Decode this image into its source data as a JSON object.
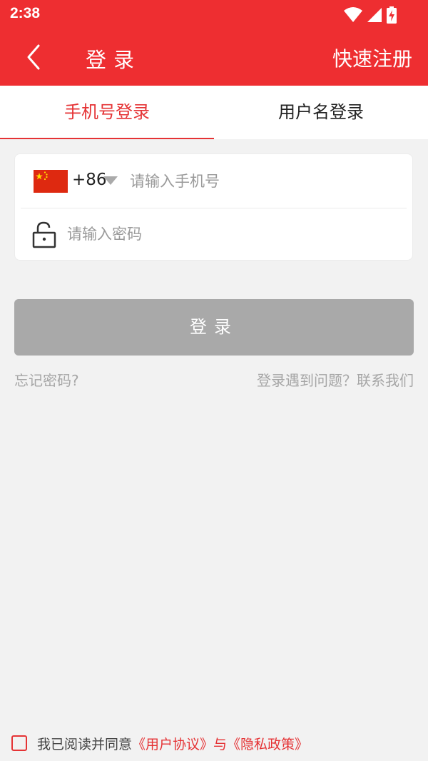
{
  "status_bar": {
    "time": "2:38",
    "icons": [
      "wifi-icon",
      "cellular-signal-icon",
      "battery-charging-icon"
    ]
  },
  "app_bar": {
    "back_icon": "chevron-left-icon",
    "title": "登录",
    "register_label": "快速注册",
    "background_color": "#ee2e31"
  },
  "tabs": [
    {
      "label": "手机号登录",
      "active": true
    },
    {
      "label": "用户名登录",
      "active": false
    }
  ],
  "form": {
    "country_flag": "china-flag-icon",
    "country_code": "+86",
    "phone_placeholder": "请输入手机号",
    "password_icon": "lock-icon",
    "password_placeholder": "请输入密码"
  },
  "login_button": {
    "label": "登录",
    "color": "#a9a9a9"
  },
  "links": {
    "forgot_password": "忘记密码?",
    "contact": "登录遇到问题？联系我们"
  },
  "agreement": {
    "prefix": "我已阅读并同意",
    "user_agreement": "《用户协议》",
    "conjunction": "与",
    "privacy_policy": "《隐私政策》",
    "accent_color": "#e53335"
  }
}
